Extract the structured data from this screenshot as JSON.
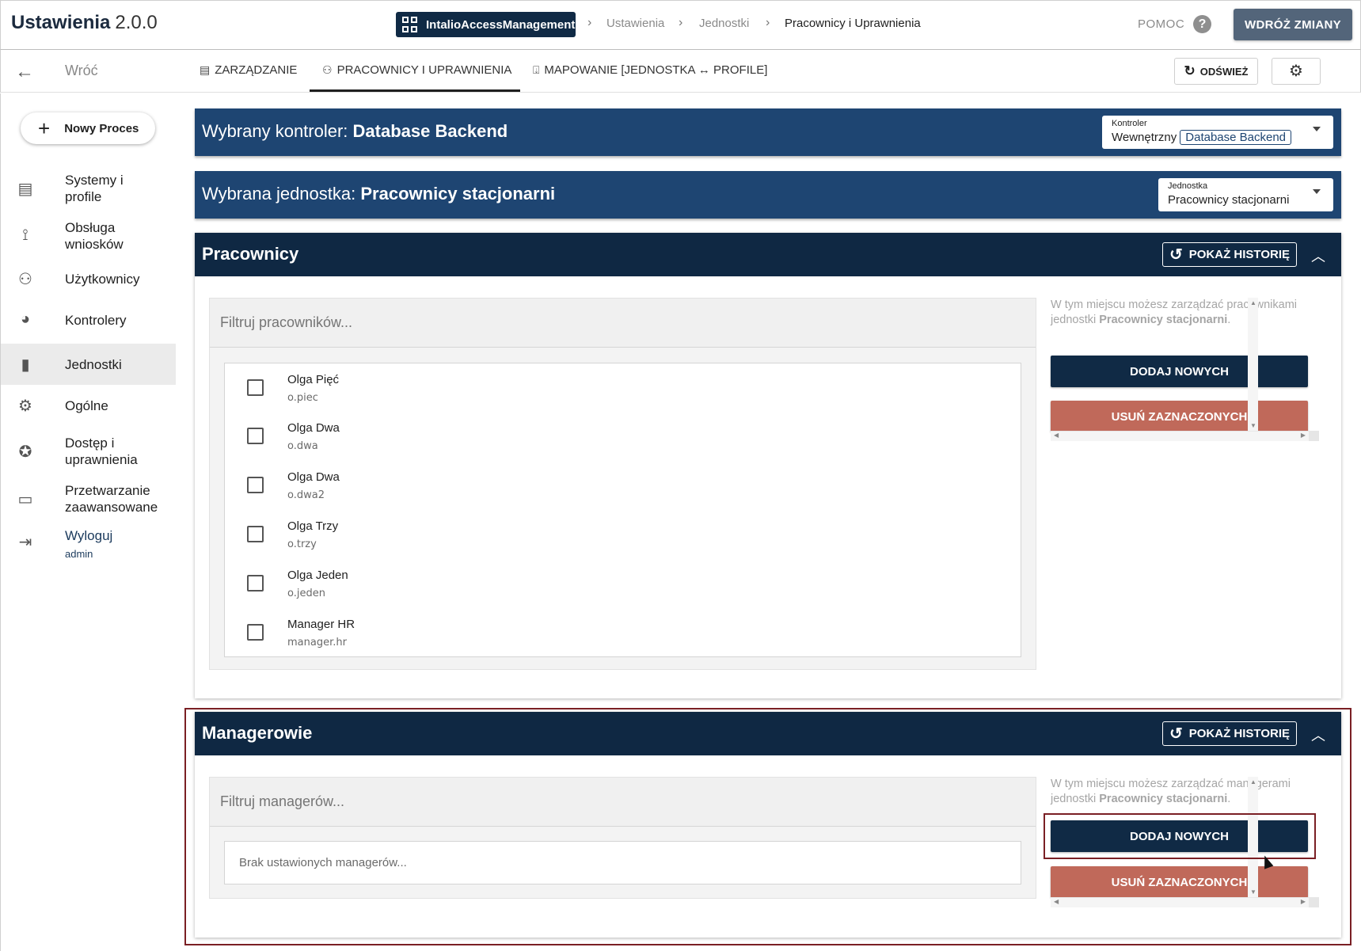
{
  "header": {
    "app_name": "Ustawienia",
    "app_version": "2.0.0",
    "breadcrumb": {
      "root": "IntalioAccessManagement",
      "items": [
        "Ustawienia",
        "Jednostki",
        "Pracownicy i Uprawnienia"
      ]
    },
    "help_label": "POMOC",
    "deploy_label": "WDRÓŻ ZMIANY"
  },
  "subbar": {
    "back_label": "Wróć",
    "tabs": [
      {
        "label": "ZARZĄDZANIE",
        "icon": "list-icon"
      },
      {
        "label": "PRACOWNICY I UPRAWNIENIA",
        "icon": "people-icon",
        "active": true
      },
      {
        "label": "MAPOWANIE [JEDNOSTKA ↔ PROFILE]",
        "icon": "import-icon"
      }
    ],
    "refresh_label": "ODŚWIEŻ"
  },
  "sidebar": {
    "new_process_label": "Nowy Proces",
    "items": [
      {
        "label": "Systemy i profile",
        "icon": "server-icon"
      },
      {
        "label": "Obsługa wniosków",
        "icon": "workflow-icon"
      },
      {
        "label": "Użytkownicy",
        "icon": "users-icon"
      },
      {
        "label": "Kontrolery",
        "icon": "controller-icon"
      },
      {
        "label": "Jednostki",
        "icon": "door-icon",
        "active": true
      },
      {
        "label": "Ogólne",
        "icon": "settings-icon"
      },
      {
        "label": "Dostęp i uprawnienia",
        "icon": "badge-icon"
      },
      {
        "label": "Przetwarzanie zaawansowane",
        "icon": "terminal-icon"
      }
    ],
    "logout_label": "Wyloguj",
    "user": "admin"
  },
  "controller_banner": {
    "prefix": "Wybrany kontroler:",
    "value": "Database Backend",
    "select_label": "Kontroler",
    "select_type": "Wewnętrzny",
    "select_value": "Database Backend"
  },
  "unit_banner": {
    "prefix": "Wybrana jednostka:",
    "value": "Pracownicy stacjonarni",
    "select_label": "Jednostka",
    "select_value": "Pracownicy stacjonarni"
  },
  "employees": {
    "title": "Pracownicy",
    "history_label": "POKAŻ HISTORIĘ",
    "filter_placeholder": "Filtruj pracowników...",
    "rows": [
      {
        "name": "Olga Pięć",
        "login": "o.piec"
      },
      {
        "name": "Olga Dwa",
        "login": "o.dwa"
      },
      {
        "name": "Olga Dwa",
        "login": "o.dwa2"
      },
      {
        "name": "Olga Trzy",
        "login": "o.trzy"
      },
      {
        "name": "Olga Jeden",
        "login": "o.jeden"
      },
      {
        "name": "Manager HR",
        "login": "manager.hr"
      }
    ],
    "info_prefix": "W tym miejscu możesz zarządzać pracownikami jednostki",
    "info_unit": "Pracownicy stacjonarni",
    "add_label": "DODAJ NOWYCH",
    "delete_label": "USUŃ ZAZNACZONYCH"
  },
  "managers": {
    "title": "Managerowie",
    "history_label": "POKAŻ HISTORIĘ",
    "filter_placeholder": "Filtruj managerów...",
    "empty_text": "Brak ustawionych managerów...",
    "info_prefix": "W tym miejscu możesz zarządzać managerami jednostki",
    "info_unit": "Pracownicy stacjonarni",
    "add_label": "DODAJ NOWYCH",
    "delete_label": "USUŃ ZAZNACZONYCH"
  },
  "colors": {
    "header_chip": "#102a45",
    "banner": "#1e4572",
    "card_header": "#0f2843",
    "delete_button": "#c0695a",
    "highlight": "#7a1f24"
  }
}
